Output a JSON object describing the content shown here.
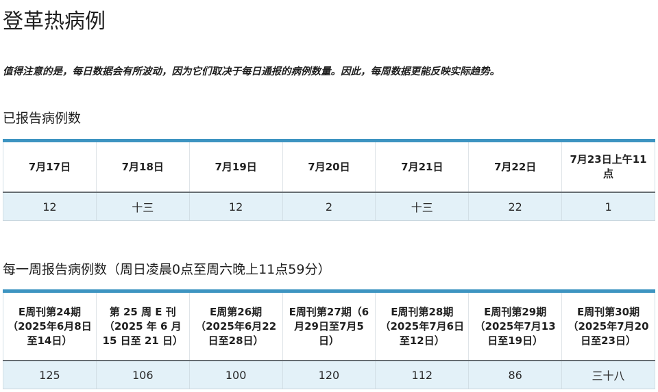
{
  "page": {
    "title": "登革热病例",
    "note": "值得注意的是，每日数据会有所波动，因为它们取决于每日通报的病例数量。因此，每周数据更能反映实际趋势。"
  },
  "daily": {
    "heading": "已报告病例数",
    "headers": [
      "7月17日",
      "7月18日",
      "7月19日",
      "7月20日",
      "7月21日",
      "7月22日",
      "7月23日上午11点"
    ],
    "values": [
      "12",
      "十三",
      "12",
      "2",
      "十三",
      "22",
      "1"
    ]
  },
  "weekly": {
    "heading": "每一周报告病例数（周日凌晨0点至周六晚上11点59分）",
    "headers": [
      "E周刊第24期（2025年6月8日至14日）",
      "第 25 周 E 刊（2025 年 6 月 15 日至 21 日）",
      "E周第26期（2025年6月22日至28日）",
      "E周刊第27期（6月29日至7月5日）",
      "E周刊第28期（2025年7月6日至12日）",
      "E周刊第29期（2025年7月13日至19日）",
      "E周刊第30期（2025年7月20日至23日）"
    ],
    "values": [
      "125",
      "106",
      "100",
      "120",
      "112",
      "86",
      "三十八"
    ]
  },
  "colors": {
    "table_top_border": "#3d94c1",
    "value_row_background": "#e3f1f8",
    "header_separator": "#666d72",
    "text": "#1f1f1f"
  }
}
